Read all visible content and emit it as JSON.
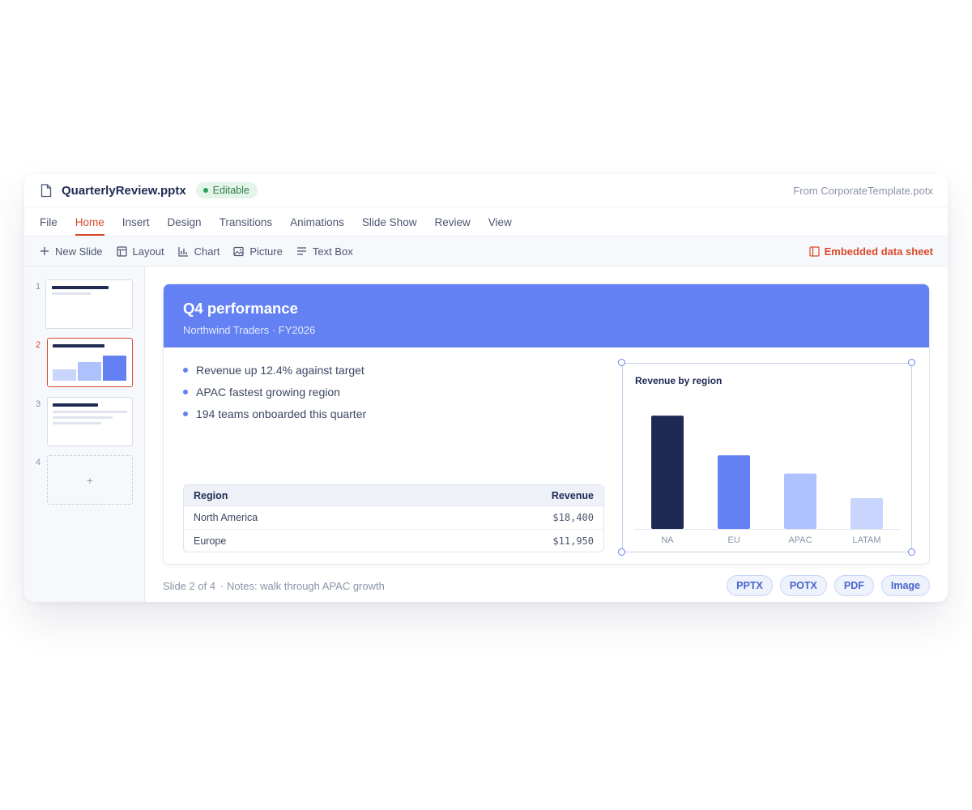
{
  "title_bar": {
    "file_name": "QuarterlyReview.pptx",
    "status_badge": "Editable",
    "template_source": "From CorporateTemplate.potx",
    "file_icon": "file-icon"
  },
  "menu": {
    "items": [
      {
        "label": "File",
        "active": false
      },
      {
        "label": "Home",
        "active": true
      },
      {
        "label": "Insert",
        "active": false
      },
      {
        "label": "Design",
        "active": false
      },
      {
        "label": "Transitions",
        "active": false
      },
      {
        "label": "Animations",
        "active": false
      },
      {
        "label": "Slide Show",
        "active": false
      },
      {
        "label": "Review",
        "active": false
      },
      {
        "label": "View",
        "active": false
      }
    ]
  },
  "toolbar": {
    "new_slide": "New Slide",
    "layout": "Layout",
    "chart": "Chart",
    "picture": "Picture",
    "text_box": "Text Box",
    "embedded_data_sheet": "Embedded data sheet"
  },
  "thumbnails": {
    "numbers": [
      "1",
      "2",
      "3",
      "4"
    ],
    "active": "2",
    "add_label": "+"
  },
  "slide": {
    "title": "Q4 performance",
    "subtitle": "Northwind Traders · FY2026",
    "bullets": [
      "Revenue up 12.4% against target",
      "APAC fastest growing region",
      "194 teams onboarded this quarter"
    ],
    "table": {
      "headers": [
        "Region",
        "Revenue"
      ],
      "rows": [
        [
          "North America",
          "$18,400"
        ],
        [
          "Europe",
          "$11,950"
        ]
      ]
    }
  },
  "chart_data": {
    "type": "bar",
    "title": "Revenue by region",
    "categories": [
      "NA",
      "EU",
      "APAC",
      "LATAM"
    ],
    "values": [
      18400,
      11950,
      9000,
      5000
    ],
    "colors": [
      "#1e2a52",
      "#6381f2",
      "#adc1fc",
      "#c8d5fd"
    ],
    "ylim": [
      0,
      20000
    ],
    "grid": false
  },
  "footer": {
    "slide_counter": "Slide 2 of 4",
    "notes": "· Notes: walk through APAC growth",
    "export_formats": [
      "PPTX",
      "POTX",
      "PDF",
      "Image"
    ]
  },
  "colors": {
    "accent": "#d94a2b",
    "primary": "#6381f2",
    "navy": "#1e2a52"
  }
}
